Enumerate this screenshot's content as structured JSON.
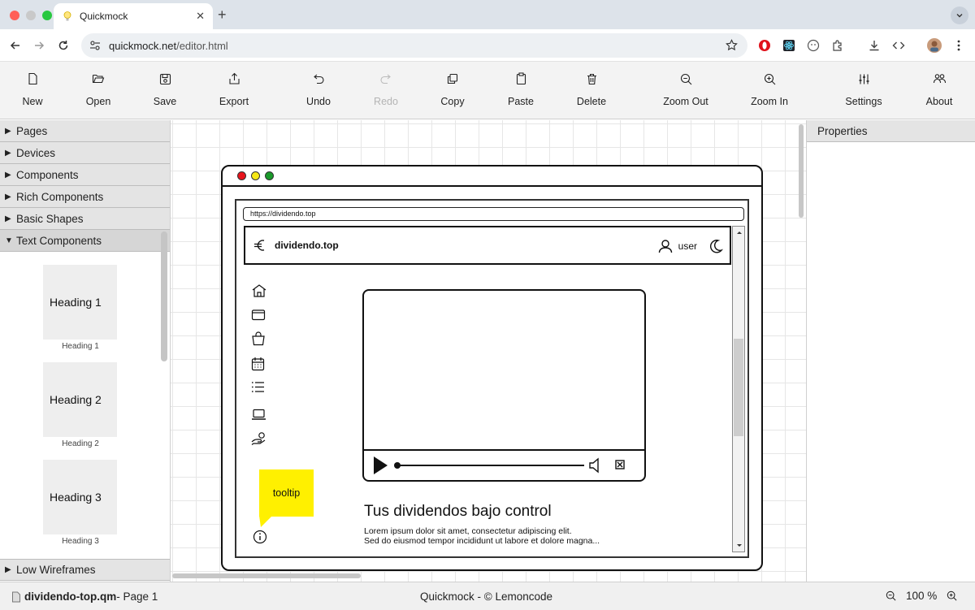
{
  "browser": {
    "tab_title": "Quickmock",
    "url_host": "quickmock.net",
    "url_path": "/editor.html"
  },
  "toolbar": [
    {
      "label": "New",
      "icon": "new-file-icon"
    },
    {
      "label": "Open",
      "icon": "folder-open-icon"
    },
    {
      "label": "Save",
      "icon": "save-icon"
    },
    {
      "label": "Export",
      "icon": "export-icon"
    },
    {
      "label": "Undo",
      "icon": "undo-icon"
    },
    {
      "label": "Redo",
      "icon": "redo-icon",
      "disabled": true
    },
    {
      "label": "Copy",
      "icon": "copy-icon"
    },
    {
      "label": "Paste",
      "icon": "paste-icon"
    },
    {
      "label": "Delete",
      "icon": "trash-icon"
    },
    {
      "label": "Zoom Out",
      "icon": "zoom-out-icon"
    },
    {
      "label": "Zoom In",
      "icon": "zoom-in-icon"
    },
    {
      "label": "Settings",
      "icon": "sliders-icon"
    },
    {
      "label": "About",
      "icon": "people-icon"
    }
  ],
  "left_panel": {
    "sections": [
      "Pages",
      "Devices",
      "Components",
      "Rich Components",
      "Basic Shapes",
      "Text Components"
    ],
    "open_section": "Text Components",
    "components": [
      {
        "preview": "Heading 1",
        "caption": "Heading 1"
      },
      {
        "preview": "Heading 2",
        "caption": "Heading 2"
      },
      {
        "preview": "Heading 3",
        "caption": "Heading 3"
      }
    ],
    "bottom_section": "Low Wireframes"
  },
  "mockup": {
    "url": "https://dividendo.top",
    "brand": "dividendo.top",
    "user": "user",
    "heading": "Tus dividendos bajo control",
    "paragraph_line1": "Lorem ipsum dolor sit amet, consectetur adipiscing elit.",
    "paragraph_line2": "Sed do eiusmod tempor incididunt ut labore et dolore magna...",
    "tooltip": "tooltip"
  },
  "right_panel": {
    "title": "Properties"
  },
  "status": {
    "file": "dividendo-top.qm",
    "page": " - Page 1",
    "center": "Quickmock - © Lemoncode",
    "zoom": "100 %"
  }
}
